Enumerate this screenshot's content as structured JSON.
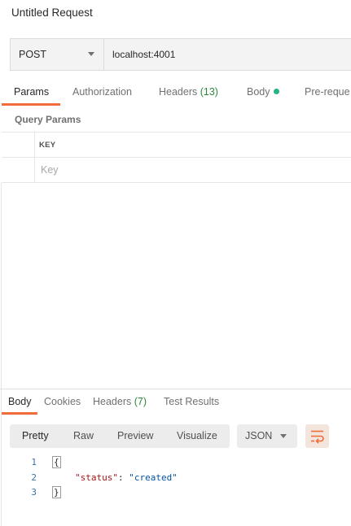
{
  "request": {
    "title": "Untitled Request",
    "method": "POST",
    "url": "localhost:4001"
  },
  "request_tabs": {
    "params": "Params",
    "authorization": "Authorization",
    "headers": "Headers",
    "headers_count": "(13)",
    "body": "Body",
    "prerequest": "Pre-reque"
  },
  "query_params": {
    "section_label": "Query Params",
    "key_header": "KEY",
    "key_placeholder": "Key"
  },
  "response_tabs": {
    "body": "Body",
    "cookies": "Cookies",
    "headers": "Headers",
    "headers_count": "(7)",
    "test_results": "Test Results"
  },
  "response_view": {
    "pretty": "Pretty",
    "raw": "Raw",
    "preview": "Preview",
    "visualize": "Visualize",
    "format": "JSON"
  },
  "response_body": {
    "line_numbers": [
      "1",
      "2",
      "3"
    ],
    "open_brace": "{",
    "key": "\"status\"",
    "separator": ": ",
    "value": "\"created\"",
    "close_brace": "}"
  },
  "icons": {
    "method_dropdown": "chevron-down-icon",
    "format_dropdown": "chevron-down-icon",
    "wrap": "wrap-lines-icon",
    "body_indicator": "dot-icon"
  },
  "colors": {
    "accent": "#f26b3a",
    "count_green": "#2b8a3e",
    "body_dot": "#26b47f"
  }
}
